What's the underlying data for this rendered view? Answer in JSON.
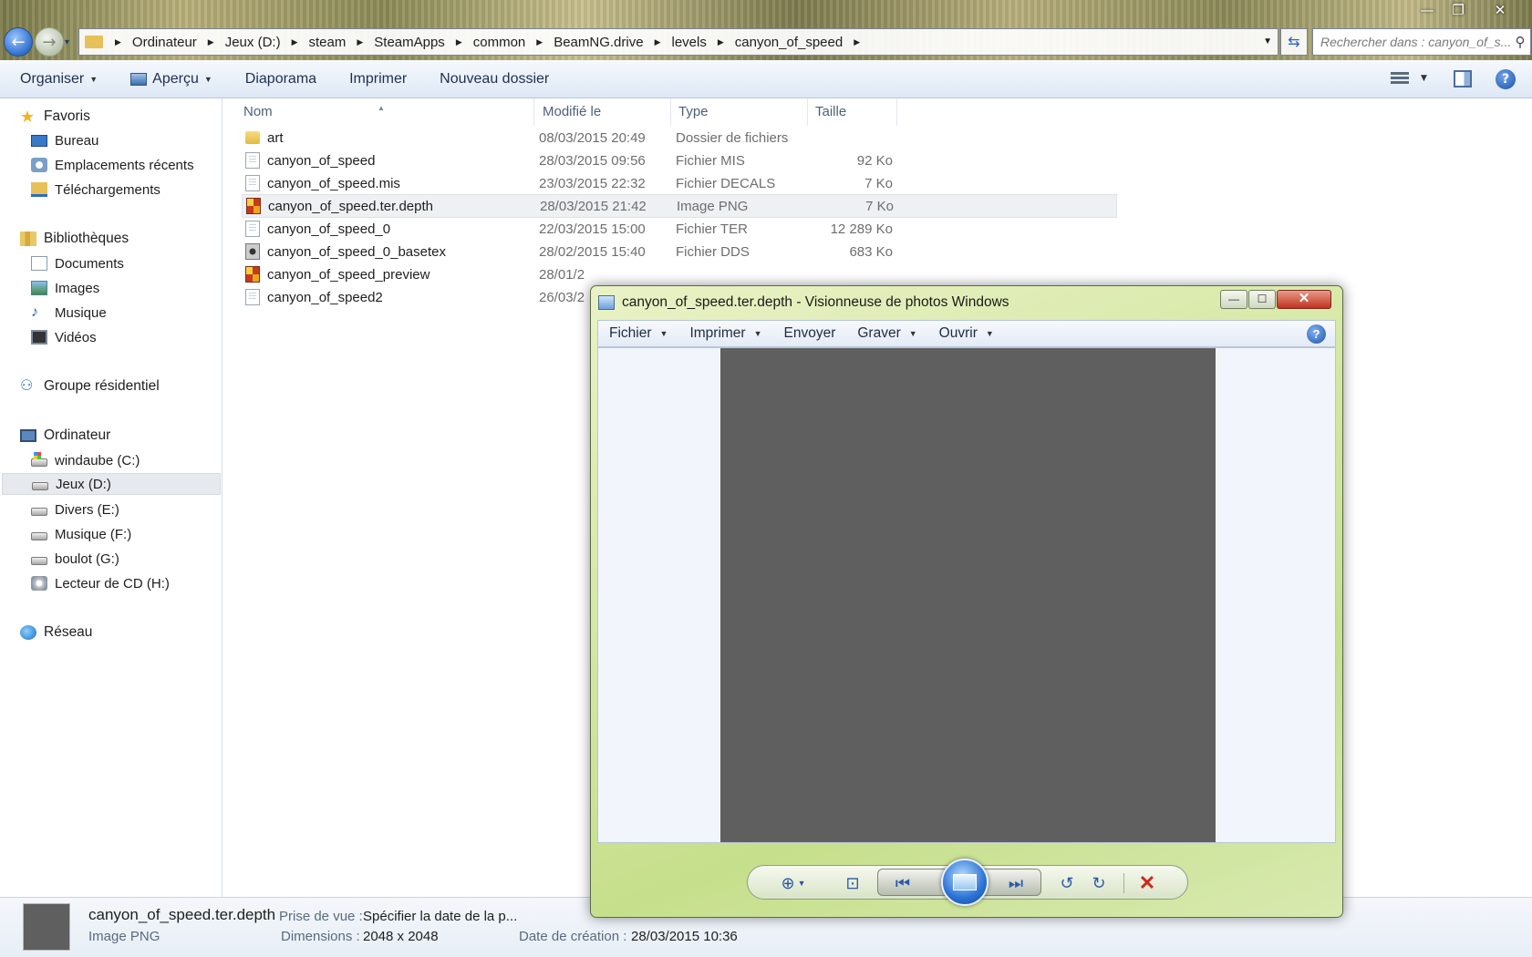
{
  "explorer": {
    "window_controls": {
      "minimize": "—",
      "maximize": "❐",
      "close": "✕"
    },
    "nav": {
      "back": "←",
      "forward": "→",
      "recent": "▾"
    },
    "breadcrumbs": [
      "Ordinateur",
      "Jeux (D:)",
      "steam",
      "SteamApps",
      "common",
      "BeamNG.drive",
      "levels",
      "canyon_of_speed"
    ],
    "search_placeholder": "Rechercher dans : canyon_of_s...",
    "toolbar": {
      "organiser": "Organiser",
      "apercu": "Aperçu",
      "diaporama": "Diaporama",
      "imprimer": "Imprimer",
      "nouveau_dossier": "Nouveau dossier"
    },
    "sidebar": {
      "favoris": {
        "label": "Favoris",
        "items": [
          "Bureau",
          "Emplacements récents",
          "Téléchargements"
        ]
      },
      "bibliotheques": {
        "label": "Bibliothèques",
        "items": [
          "Documents",
          "Images",
          "Musique",
          "Vidéos"
        ]
      },
      "groupe": {
        "label": "Groupe résidentiel"
      },
      "ordinateur": {
        "label": "Ordinateur",
        "items": [
          "windaube (C:)",
          "Jeux (D:)",
          "Divers (E:)",
          "Musique (F:)",
          "boulot (G:)",
          "Lecteur de CD (H:)"
        ]
      },
      "reseau": {
        "label": "Réseau"
      },
      "selected": "Jeux (D:)"
    },
    "columns": {
      "name": "Nom",
      "modified": "Modifié le",
      "type": "Type",
      "size": "Taille"
    },
    "files": [
      {
        "name": "art",
        "date": "08/03/2015 20:49",
        "type": "Dossier de fichiers",
        "size": "",
        "icon": "folder-icon"
      },
      {
        "name": "canyon_of_speed",
        "date": "28/03/2015 09:56",
        "type": "Fichier MIS",
        "size": "92 Ko",
        "icon": "file-icon"
      },
      {
        "name": "canyon_of_speed.mis",
        "date": "23/03/2015 22:32",
        "type": "Fichier DECALS",
        "size": "7 Ko",
        "icon": "file-icon"
      },
      {
        "name": "canyon_of_speed.ter.depth",
        "date": "28/03/2015 21:42",
        "type": "Image PNG",
        "size": "7 Ko",
        "icon": "png-icon"
      },
      {
        "name": "canyon_of_speed_0",
        "date": "22/03/2015 15:00",
        "type": "Fichier TER",
        "size": "12 289 Ko",
        "icon": "file-icon"
      },
      {
        "name": "canyon_of_speed_0_basetex",
        "date": "28/02/2015 15:40",
        "type": "Fichier DDS",
        "size": "683 Ko",
        "icon": "dds-icon"
      },
      {
        "name": "canyon_of_speed_preview",
        "date": "28/01/2",
        "type": "",
        "size": "",
        "icon": "png-icon"
      },
      {
        "name": "canyon_of_speed2",
        "date": "26/03/2",
        "type": "",
        "size": "",
        "icon": "file-icon"
      }
    ],
    "selected_file_index": 3,
    "details": {
      "filename": "canyon_of_speed.ter.depth",
      "filetype": "Image PNG",
      "prise_label": "Prise de vue :",
      "prise_value": "Spécifier la date de la p...",
      "dim_label": "Dimensions :",
      "dim_value": "2048 x 2048",
      "creation_label": "Date de création :",
      "creation_value": "28/03/2015 10:36"
    }
  },
  "viewer": {
    "title": "canyon_of_speed.ter.depth - Visionneuse de photos Windows",
    "controls": {
      "minimize": "—",
      "maximize": "☐",
      "close": "✕"
    },
    "menu": [
      "Fichier",
      "Imprimer",
      "Envoyer",
      "Graver",
      "Ouvrir"
    ],
    "help": "?",
    "image_color": "#5f5f5f"
  }
}
